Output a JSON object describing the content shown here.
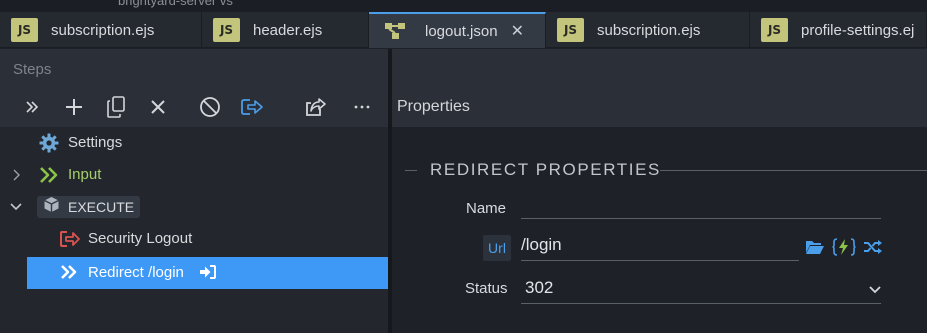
{
  "window": {
    "title_fragment": "brightyard-server vs"
  },
  "tabs": [
    {
      "label": "subscription.ejs",
      "icon": "js-file-icon",
      "badge": "JS",
      "active": false
    },
    {
      "label": "header.ejs",
      "icon": "js-file-icon",
      "badge": "JS",
      "active": false
    },
    {
      "label": "logout.json",
      "icon": "flow-json-icon",
      "active": true,
      "close": "✕"
    },
    {
      "label": "subscription.ejs",
      "icon": "js-file-icon",
      "badge": "JS",
      "active": false
    },
    {
      "label": "profile-settings.ej",
      "icon": "js-file-icon",
      "badge": "JS",
      "active": false
    }
  ],
  "steps_panel": {
    "title": "Steps",
    "toolbar": [
      "expand-all-icon",
      "add-icon",
      "copy-icon",
      "delete-icon",
      "disable-icon",
      "export-icon",
      "share-icon",
      "more-icon"
    ],
    "tree": [
      {
        "label": "Settings",
        "icon": "gear-icon",
        "indent": 1
      },
      {
        "label": "Input",
        "icon": "input-chevrons-icon",
        "expander": "collapsed"
      },
      {
        "label": "EXECUTE",
        "icon": "cube-icon",
        "expander": "expanded"
      },
      {
        "label": "Security Logout",
        "icon": "logout-icon",
        "indent": 2
      },
      {
        "label": "Redirect /login",
        "icon": "redirect-chevrons-icon",
        "indent": 2,
        "selected": true,
        "trailing_icon": "sign-in-icon"
      }
    ]
  },
  "properties_panel": {
    "title": "Properties",
    "section": "REDIRECT PROPERTIES",
    "name_label": "Name",
    "name_value": "",
    "url_badge": "Url",
    "url_value": "/login",
    "url_actions": [
      "folder-open-icon",
      "expression-icon",
      "shuffle-icon"
    ],
    "status_label": "Status",
    "status_value": "302"
  },
  "colors": {
    "accent": "#3d99f5",
    "js_badge": "#c3c57c",
    "input_green": "#8bc34a",
    "logout_red": "#d9534f",
    "gear": "#6fa8d6",
    "url_blue": "#4a9eea"
  }
}
